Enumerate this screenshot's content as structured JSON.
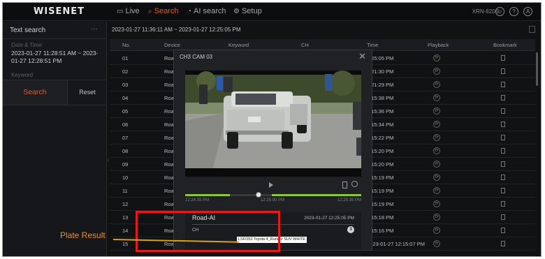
{
  "app": {
    "logo": "WISENET",
    "nav": [
      {
        "label": "Live",
        "icon": "monitor-icon"
      },
      {
        "label": "Search",
        "icon": "search-icon",
        "active": true
      },
      {
        "label": "AI search",
        "icon": "ai-search-icon"
      },
      {
        "label": "Setup",
        "icon": "gear-icon"
      }
    ],
    "model": "XRN-820S",
    "accent_color": "#e05a34"
  },
  "left_panel": {
    "title": "Text search",
    "more": "···",
    "date_label": "Date & Time",
    "date_value": "2023-01-27 11:28:51 AM ~ 2023-01-27 12:28:51 PM",
    "keyword_label": "Keyword",
    "search_button": "Search",
    "reset_button": "Reset"
  },
  "results": {
    "range": "2023-01-27 11:36:11 AM ~ 2023-01-27 12:25:05 PM",
    "columns": [
      "No.",
      "Device",
      "Keyword",
      "CH",
      "Time",
      "Playback",
      "Bookmark"
    ],
    "rows": [
      {
        "no": "01",
        "device": "Road",
        "time": "2:25:05 PM"
      },
      {
        "no": "02",
        "device": "Road",
        "time": "2:21:30 PM"
      },
      {
        "no": "03",
        "device": "Road",
        "time": "2:21:29 PM"
      },
      {
        "no": "04",
        "device": "Road",
        "time": "2:15:38 PM"
      },
      {
        "no": "05",
        "device": "Road",
        "time": "2:15:36 PM"
      },
      {
        "no": "06",
        "device": "Road",
        "time": "2:15:34 PM"
      },
      {
        "no": "07",
        "device": "Road",
        "time": "2:15:22 PM"
      },
      {
        "no": "08",
        "device": "Road",
        "time": "2:15:20 PM"
      },
      {
        "no": "09",
        "device": "Road",
        "time": "2:15:20 PM"
      },
      {
        "no": "10",
        "device": "Road",
        "time": "2:15:19 PM"
      },
      {
        "no": "11",
        "device": "Road",
        "time": "2:15:19 PM"
      },
      {
        "no": "12",
        "device": "Road",
        "time": "2:15:19 PM"
      },
      {
        "no": "13",
        "device": "Road",
        "time": "2:15:18 PM"
      },
      {
        "no": "14",
        "device": "Road",
        "time": "2:15:16 PM"
      },
      {
        "no": "15",
        "device": "Road-AI",
        "time": "2023-01-27 12:15:07 PM"
      }
    ]
  },
  "modal": {
    "title": "CH3 CAM 03",
    "timeline_ticks": [
      "12:24:35 PM",
      "12:25:00 PM",
      "12:25:35 PM"
    ],
    "card": {
      "title": "Road-AI",
      "time": "2023-01-27 12:25:05 PM",
      "ch_label": "CH",
      "ch_value": "3",
      "plate": "LSFO53 Toyota 4_Runner SUV WHITE"
    }
  },
  "annotation": {
    "label": "Plate Result",
    "box_color": "#e8191b",
    "text_color": "#f08f1b"
  }
}
